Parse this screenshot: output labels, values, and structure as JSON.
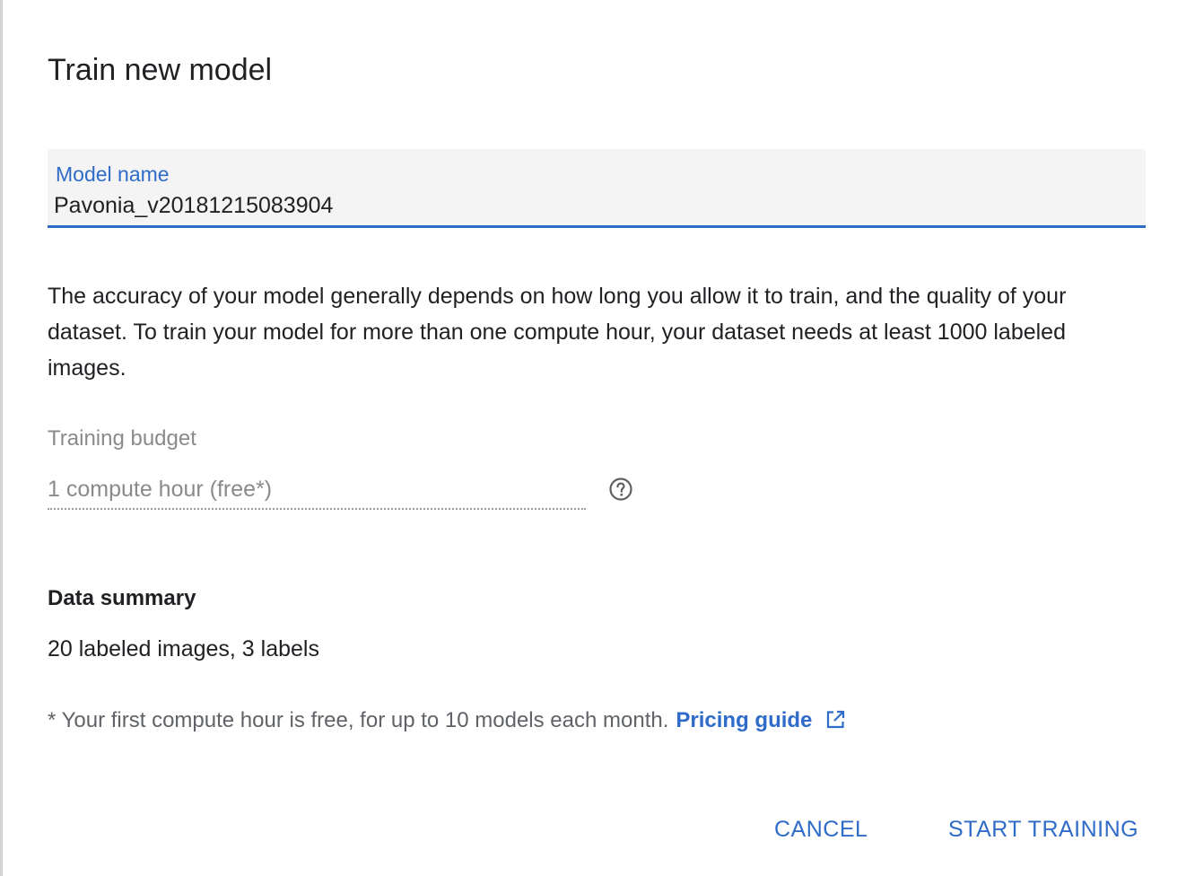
{
  "dialog": {
    "title": "Train new model"
  },
  "model_name": {
    "label": "Model name",
    "value": "Pavonia_v20181215083904"
  },
  "description": "The accuracy of your model generally depends on how long you allow it to train, and the quality of your dataset. To train your model for more than one compute hour, your dataset needs at least 1000 labeled images.",
  "training_budget": {
    "label": "Training budget",
    "value": "1 compute hour (free*)",
    "help_icon": "help-circle-icon"
  },
  "data_summary": {
    "heading": "Data summary",
    "value": "20 labeled images, 3 labels"
  },
  "footnote": {
    "text": "* Your first compute hour is free, for up to 10 models each month.",
    "link_label": "Pricing guide",
    "link_icon": "open-in-new-icon"
  },
  "actions": {
    "cancel_label": "CANCEL",
    "start_label": "START TRAINING"
  },
  "colors": {
    "accent": "#2f6bc8",
    "text": "#202124",
    "muted": "#8a8a8a",
    "field_bg": "#f3f4f3"
  }
}
